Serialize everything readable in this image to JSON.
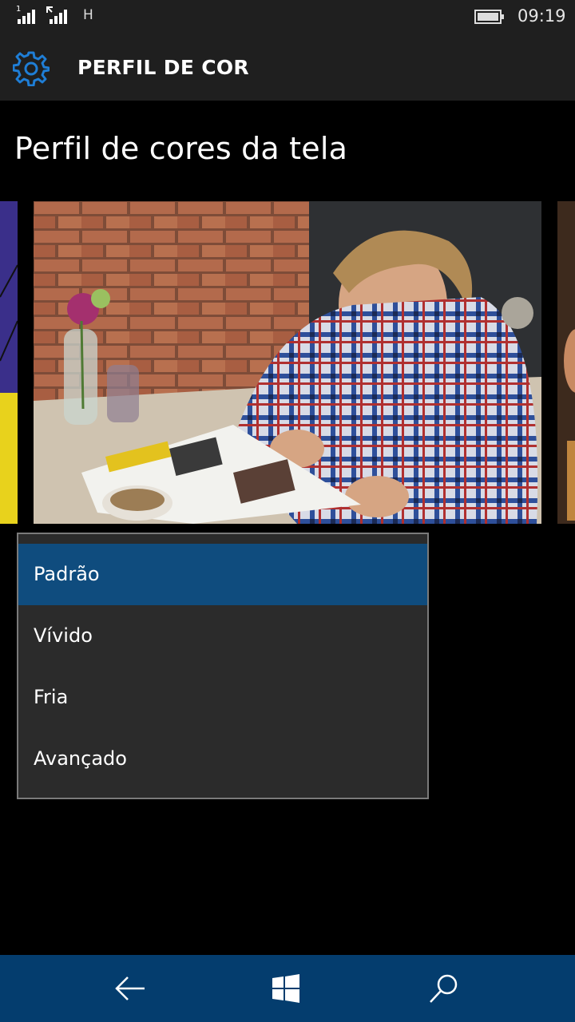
{
  "status_bar": {
    "sim1_label": "1",
    "network_type": "H",
    "time": "09:19",
    "icons": [
      "signal-sim1-icon",
      "signal-sim2-icon",
      "battery-icon"
    ]
  },
  "header": {
    "title": "PERFIL DE COR",
    "icon": "gear-icon",
    "accent_color": "#1f7ed6"
  },
  "page": {
    "title": "Perfil de cores da tela"
  },
  "dropdown": {
    "options": [
      "Padrão",
      "Vívido",
      "Fria",
      "Avançado"
    ],
    "selected": "Padrão",
    "selected_color": "#0f4c7e"
  },
  "nav_bar": {
    "buttons": [
      "back-arrow-icon",
      "windows-start-icon",
      "search-icon"
    ],
    "color": "#043d6e"
  }
}
